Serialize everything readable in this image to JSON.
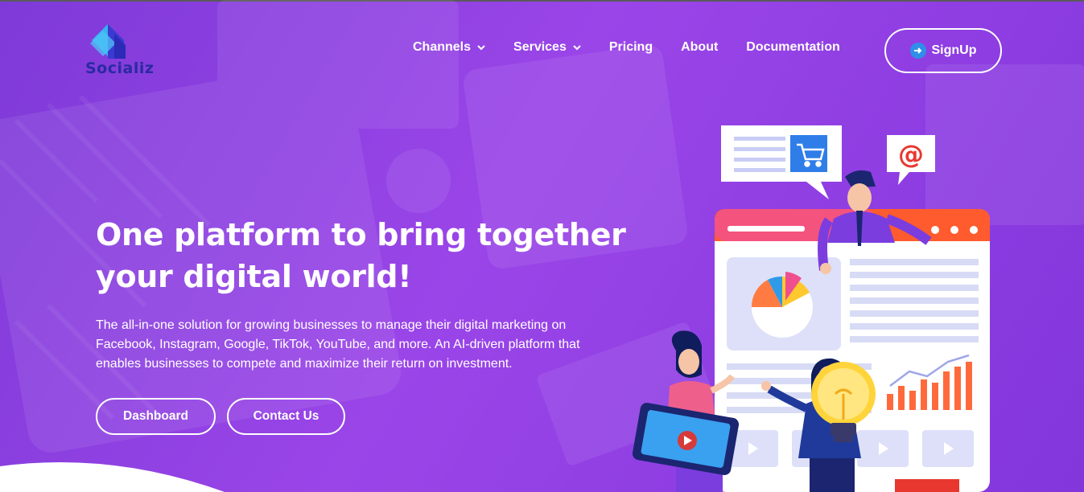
{
  "brand": {
    "name": "Socializ",
    "logo_text": "Socializ"
  },
  "nav": {
    "items": [
      {
        "label": "Channels",
        "has_dropdown": true
      },
      {
        "label": "Services",
        "has_dropdown": true
      },
      {
        "label": "Pricing",
        "has_dropdown": false
      },
      {
        "label": "About",
        "has_dropdown": false
      },
      {
        "label": "Documentation",
        "has_dropdown": false
      }
    ],
    "signup_label": "SignUp"
  },
  "hero": {
    "headline_line1": "One platform to bring together",
    "headline_line2": "your digital world!",
    "description": "The all-in-one solution for growing businesses to manage their digital marketing on Facebook, Instagram, Google, TikTok, YouTube, and more. An AI-driven platform that enables businesses to compete and maximize their return on investment.",
    "dashboard_label": "Dashboard",
    "contact_label": "Contact Us"
  },
  "illustration": {
    "at_symbol": "@"
  },
  "colors": {
    "background": "#8a3fe0",
    "logo_blue": "#2a2aa0",
    "signup_icon": "#2f8fe8",
    "accent_orange": "#ff6a3d"
  }
}
